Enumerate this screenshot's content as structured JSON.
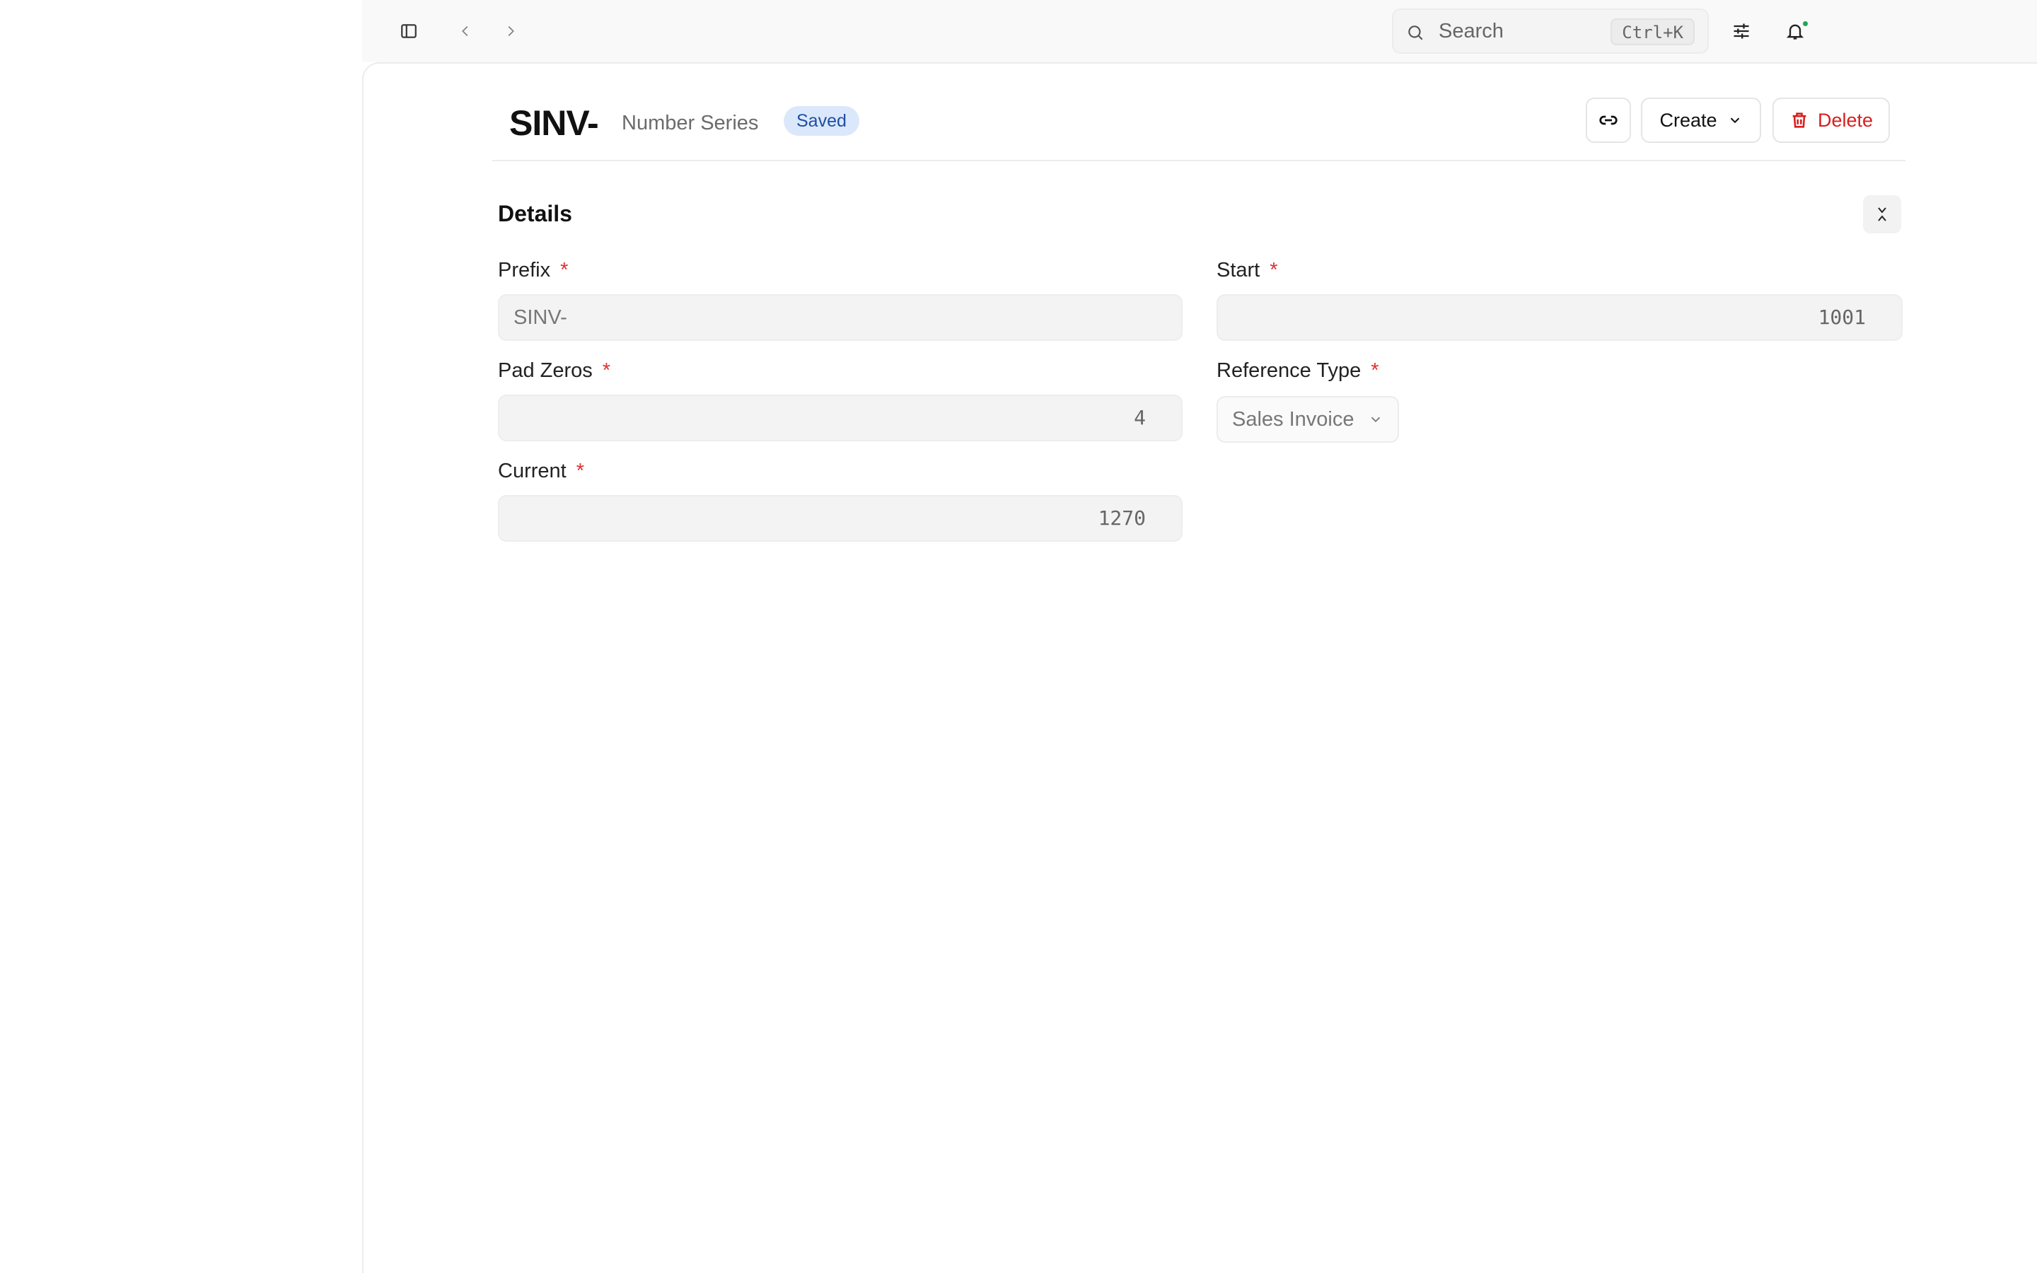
{
  "topbar": {
    "search_placeholder": "Search",
    "search_shortcut": "Ctrl+K"
  },
  "doc": {
    "title": "SINV-",
    "doctype": "Number Series",
    "status": "Saved",
    "create_label": "Create",
    "delete_label": "Delete"
  },
  "section": {
    "title": "Details"
  },
  "fields": {
    "prefix": {
      "label": "Prefix",
      "required": "*",
      "value": "SINV-"
    },
    "start": {
      "label": "Start",
      "required": "*",
      "value": "1001"
    },
    "pad_zeros": {
      "label": "Pad Zeros",
      "required": "*",
      "value": "4"
    },
    "reference_type": {
      "label": "Reference Type",
      "required": "*",
      "value": "Sales Invoice"
    },
    "current": {
      "label": "Current",
      "required": "*",
      "value": "1270"
    }
  },
  "colors": {
    "accent_red": "#d91e1e",
    "badge_bg": "#dbe8fb",
    "badge_text": "#1f4fa3",
    "notification_dot": "#22a559"
  },
  "icons": {
    "sidebar_toggle": "sidebar-toggle-icon",
    "back": "chevron-left-icon",
    "forward": "chevron-right-icon",
    "search": "search-icon",
    "filters": "sliders-icon",
    "notifications": "bell-icon",
    "link": "link-icon",
    "create_dropdown": "chevron-down-icon",
    "delete": "trash-icon",
    "collapse": "collapse-icon"
  }
}
